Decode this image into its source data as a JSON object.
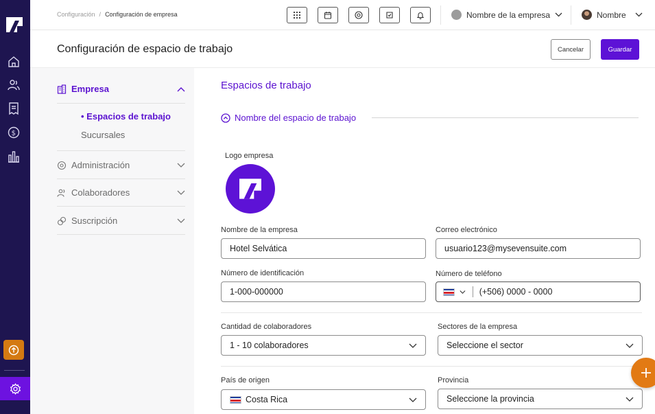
{
  "breadcrumb": {
    "parent": "Configuración",
    "separator": "/",
    "current": "Configuración de empresa"
  },
  "topbar": {
    "icons": [
      "apps-grid-icon",
      "calendar-icon",
      "target-icon",
      "badge-icon",
      "bell-icon"
    ],
    "company_select": "Nombre de la empresa",
    "user_name": "Nombre"
  },
  "header": {
    "title": "Configuración de espacio de trabajo",
    "cancel_label": "Cancelar",
    "save_label": "Guardar"
  },
  "sidemenu": {
    "sections": [
      {
        "label": "Empresa",
        "icon": "building-icon",
        "expanded": true
      },
      {
        "label": "Administración",
        "icon": "admin-icon",
        "expanded": false
      },
      {
        "label": "Colaboradores",
        "icon": "users-icon",
        "expanded": false
      },
      {
        "label": "Suscripción",
        "icon": "subscription-icon",
        "expanded": false
      }
    ],
    "empresa_items": [
      {
        "label": "• Espacios de trabajo",
        "active": true
      },
      {
        "label": "Sucursales",
        "active": false
      }
    ]
  },
  "main": {
    "section_title": "Espacios de trabajo",
    "group_title": "Nombre del espacio de trabajo",
    "logo_label": "Logo empresa",
    "fields": {
      "company_name": {
        "label": "Nombre de la empresa",
        "value": "Hotel Selvática"
      },
      "email": {
        "label": "Correo electrónico",
        "value": "usuario123@mysevensuite.com"
      },
      "id_number": {
        "label": "Número de identificación",
        "value": "1-000-000000"
      },
      "phone": {
        "label": "Número de teléfono",
        "value": "(+506) 0000 - 0000"
      },
      "collaborators": {
        "label": "Cantidad de colaboradores",
        "value": "1 - 10 colaboradores"
      },
      "sectors": {
        "label": "Sectores de la empresa",
        "value": "Seleccione el sector"
      },
      "country": {
        "label": "País de origen",
        "value": "Costa Rica"
      },
      "province": {
        "label": "Provincia",
        "value": "Seleccione la provincia"
      }
    }
  },
  "colors": {
    "accent": "#5d12d6",
    "rail": "#1e1550",
    "orange": "#e27a14"
  }
}
